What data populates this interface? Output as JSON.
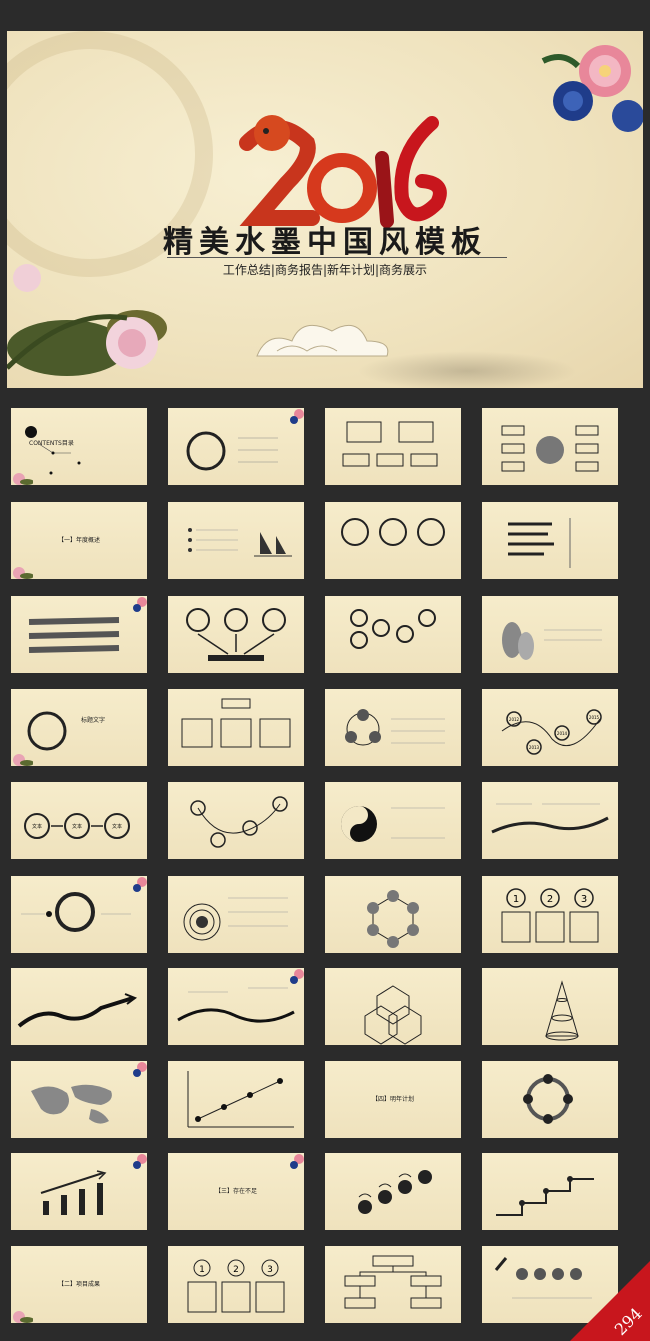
{
  "hero": {
    "year": "2016",
    "title": "精美水墨中国风模板",
    "subtitle": "工作总结|商务报告|新年计划|商务展示"
  },
  "slides": {
    "contents": "CONTENTS目录",
    "part1": "【一】年度概述",
    "part2": "【二】项目成果",
    "part3": "【三】存在不足",
    "part4": "【四】明年计划",
    "text_a": "文本",
    "text_b": "文本",
    "text_c": "文本",
    "point_here": "点击此处添加字",
    "title_text": "标题文字",
    "years": [
      "2012",
      "2013",
      "2014",
      "2015"
    ],
    "nums": [
      "1",
      "2",
      "3"
    ]
  },
  "badge": "294"
}
